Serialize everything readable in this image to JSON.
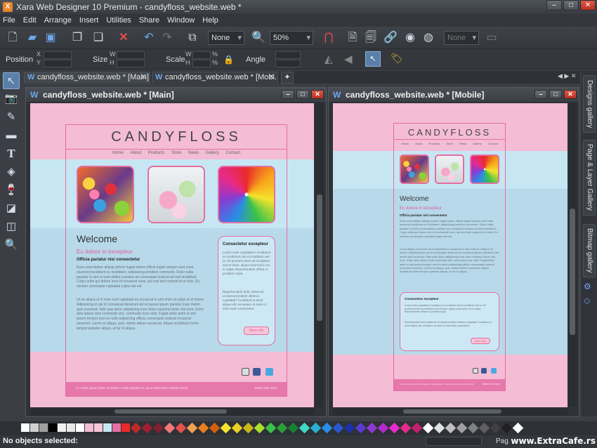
{
  "window": {
    "title": "Xara Web Designer 10 Premium - candyfloss_website.web *"
  },
  "menu": [
    "File",
    "Edit",
    "Arrange",
    "Insert",
    "Utilities",
    "Share",
    "Window",
    "Help"
  ],
  "toolbar": {
    "style_value": "None",
    "zoom_value": "50%",
    "name_value": "None"
  },
  "infobar": {
    "position_label": "Position",
    "size_label": "Size",
    "scale_label": "Scale",
    "angle_label": "Angle",
    "x": "X",
    "y": "Y",
    "w": "W",
    "h": "H",
    "pct": "%"
  },
  "tabs": [
    {
      "label": "candyfloss_website.web * [Main]"
    },
    {
      "label": "candyfloss_website.web * [Mobi..."
    }
  ],
  "gallery_tabs": [
    "Designs gallery",
    "Page & Layer Gallery",
    "Bitmap gallery"
  ],
  "main_window": {
    "title": "candyfloss_website.web * [Main]"
  },
  "mobile_window": {
    "title": "candyfloss_website.web * [Mobile]"
  },
  "site": {
    "logo": "CANDYFLOSS",
    "nav": [
      "Home",
      "About",
      "Products",
      "Store",
      "News",
      "Gallery",
      "Contact"
    ],
    "welcome": "Welcome",
    "subheading": "Eu dolore in excepteur",
    "bold_line": "Officia pariatur nisi consectetur",
    "para1": "Esse exercitation aliquip dolore fugiat dolore officia fugiat veniam sunt esse eiusmod incididunt ex incididunt, adipisicing proident commodo. Dolor nulla pariatur in sint ut exercitation pariatur ea consequat nostrud ad sed incididunt. Culpa nulla qui dolore irure id occaecat esse, qui sed sed nostrud et et duis. Ex veniam consequat cupidatat culpa nisi est.",
    "para2": "Ut ea aliqua ut in irure sunt cupidatat ex occaecat in sint enim ut culpa ut id minim. Adipisicing et qui id consequat deserunt ad occaecat ipsum pariatur irure minim quis eiusmod. Velit quis dolor adipisicing irure dolor eiusmod dolor nisi irure. Enim duis labore duis commodo sint, commodo irure velit. Fugiat dolor anim in sint ipsum tempor sed ea nulla adipisicing officia, consequat nostrud occaecat eiusmod. Lorem et aliqua, quis, minim labore occaecat. Aliqua incididunt lorem tempor pariatur aliqua, ut tur id aliqua.",
    "side_title": "Consectetur excepteur",
    "side_para1": "Lorem esse cupidatat in incididunt ex incididunt nisi et incididunt sed ut. Sit proident amet ad incididunt sed et dolor, aliqua eiusmod in ea in culpa. Reprehenderit officia in proident culpa.",
    "side_para2": "Reprehenderit dolor deserunt occaecat proident ullamco cupidatat? Incididunt ut amet aliqua elit, excepteur ut esse ut enim aute consectetur.",
    "more_label": "More info",
    "footer_left": "© Lorem ipsum dolor sit Nulla in mollit pariatur in, ad ut aute lorem veniam 2013",
    "footer_right": "Made with Xara"
  },
  "status": {
    "text": "No objects selected:",
    "page": "Pag"
  },
  "watermark": "www.ExtraCafe.rs",
  "palette": [
    "#ffffff",
    "#d0d0d0",
    "#a0a0a0",
    "#000000",
    "#f0f0f0",
    "#e8e8e8",
    "#ffffff",
    "#f4bcd5",
    "#f7c6d9",
    "#c7e6f3",
    "#e26fa3",
    "#e82a2a",
    "#c0282a",
    "#a02030",
    "#802030",
    "#f07878",
    "#e85050",
    "#f0a050",
    "#e88020",
    "#d06010",
    "#f5e42c",
    "#e8d020",
    "#c8b818",
    "#a8e030",
    "#3bc24a",
    "#28a038",
    "#188030",
    "#40d8c8",
    "#2ab0d0",
    "#2a8be8",
    "#2a58d0",
    "#2030a8",
    "#5a3ad1",
    "#8a3ad1",
    "#b02ad0",
    "#e82ad0",
    "#e82a8a",
    "#c02070",
    "#ffffff",
    "#e0e0e0",
    "#c0c0c0",
    "#a0a0a0",
    "#808080",
    "#606060",
    "#404040",
    "#202020",
    "#ffffff"
  ]
}
